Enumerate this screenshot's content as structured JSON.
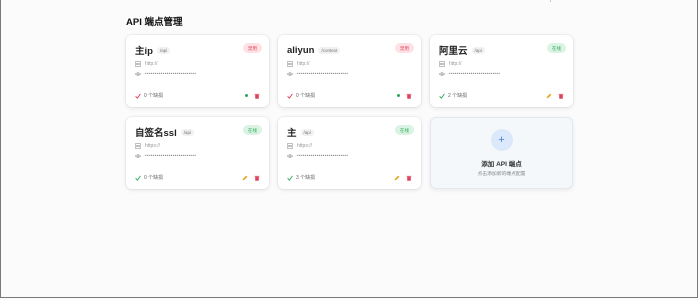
{
  "page": {
    "title": "API 端点管理",
    "corner_mark": "'"
  },
  "cards": [
    {
      "name": "主ip",
      "tag": "/api",
      "status": "禁用",
      "status_type": "off",
      "url": "http://",
      "masked_key": "••••••••••••••••••••••••••",
      "models": "0 个缺损",
      "actions": [
        "dot",
        "delete"
      ]
    },
    {
      "name": "aliyun",
      "tag": "/context",
      "status": "禁用",
      "status_type": "off",
      "url": "http://",
      "masked_key": "••••••••••••••••••••••••••",
      "models": "0 个缺损",
      "actions": [
        "dot",
        "delete"
      ]
    },
    {
      "name": "阿里云",
      "tag": "/api",
      "status": "在线",
      "status_type": "on",
      "url": "http://",
      "masked_key": "••••••••••••••••••••••••••",
      "models": "2 个缺损",
      "actions": [
        "edit",
        "delete"
      ]
    },
    {
      "name": "自签名ssl",
      "tag": "/api",
      "status": "在线",
      "status_type": "on",
      "url": "https://",
      "masked_key": "••••••••••••••••••••••••••",
      "models": "0 个缺损",
      "actions": [
        "edit",
        "delete"
      ]
    },
    {
      "name": "主",
      "tag": "/api",
      "status": "在线",
      "status_type": "on",
      "url": "https://",
      "masked_key": "••••••••••••••••••••••••••",
      "models": "3 个缺损",
      "actions": [
        "edit",
        "delete"
      ]
    }
  ],
  "add_card": {
    "plus": "+",
    "title": "添加 API 端点",
    "subtitle": "点击添加新的端点配置"
  },
  "icons": {
    "server": "server-icon",
    "eye": "eye-icon",
    "check": "check-icon",
    "dot": "status-dot-icon",
    "edit": "edit-icon",
    "delete": "trash-icon"
  },
  "colors": {
    "danger": "#e0425b",
    "danger_bg": "#fde1e5",
    "success": "#2ea85c",
    "success_bg": "#dbf3e3",
    "accent": "#4a7fd8",
    "edit": "#e7a21a"
  }
}
